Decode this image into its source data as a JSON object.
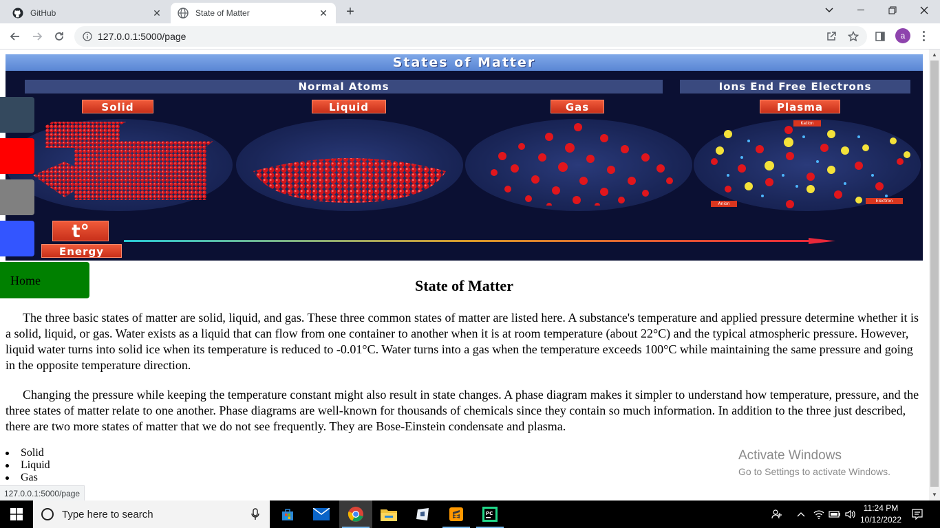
{
  "browser": {
    "tabs": [
      {
        "title": "GitHub",
        "active": false
      },
      {
        "title": "State of Matter",
        "active": true
      }
    ],
    "url": "127.0.0.1:5000/page",
    "avatar_letter": "a",
    "status_url": "127.0.0.1:5000/page"
  },
  "banner": {
    "title": "States of Matter",
    "group_normal": "Normal Atoms",
    "group_ions": "Ions End Free Electrons",
    "states": [
      "Solid",
      "Liquid",
      "Gas",
      "Plasma"
    ],
    "plasma_tags": [
      "Kation",
      "Anion",
      "Electron"
    ],
    "energy_symbol": "t°",
    "energy_label": "Energy"
  },
  "side_blocks": [
    {
      "color": "#34495e"
    },
    {
      "color": "#ff0000"
    },
    {
      "color": "#808080"
    },
    {
      "color": "#3355ff"
    }
  ],
  "nav": {
    "home_label": "Home",
    "home_color": "#008000"
  },
  "article": {
    "heading": "State of Matter",
    "paragraphs": [
      "The three basic states of matter are solid, liquid, and gas. These three common states of matter are listed here. A substance's temperature and applied pressure determine whether it is a solid, liquid, or gas. Water exists as a liquid that can flow from one container to another when it is at room temperature (about 22°C) and the typical atmospheric pressure. However, liquid water turns into solid ice when its temperature is reduced to -0.01°C. Water turns into a gas when the temperature exceeds 100°C while maintaining the same pressure and going in the opposite temperature direction.",
      "Changing the pressure while keeping the temperature constant might also result in state changes. A phase diagram makes it simpler to understand how temperature, pressure, and the three states of matter relate to one another. Phase diagrams are well-known for thousands of chemicals since they contain so much information. In addition to the three just described, there are two more states of matter that we do not see frequently. They are Bose-Einstein condensate and plasma."
    ],
    "list": [
      "Solid",
      "Liquid",
      "Gas"
    ]
  },
  "watermark": {
    "line1": "Activate Windows",
    "line2": "Go to Settings to activate Windows."
  },
  "taskbar": {
    "search_placeholder": "Type here to search",
    "time": "11:24 PM",
    "date": "10/12/2022"
  }
}
